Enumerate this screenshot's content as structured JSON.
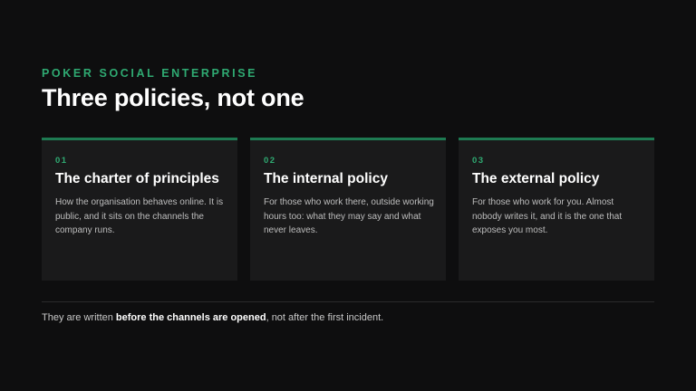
{
  "header": {
    "kicker": "POKER SOCIAL ENTERPRISE",
    "title": "Three policies, not one"
  },
  "cards": [
    {
      "number": "01",
      "heading": "The charter of principles",
      "body": "How the organisation behaves online. It is public, and it sits on the channels the company runs."
    },
    {
      "number": "02",
      "heading": "The internal policy",
      "body": "For those who work there, outside working hours too: what they may say and what never leaves."
    },
    {
      "number": "03",
      "heading": "The external policy",
      "body": "For those who work for you. Almost nobody writes it, and it is the one that exposes you most."
    }
  ],
  "footer": {
    "before": "They are written ",
    "emphasis": "before the channels are opened",
    "after": ", not after the first incident."
  },
  "colors": {
    "background": "#0e0e0f",
    "accent": "#2faa72",
    "card_border": "#1e7a52",
    "card_background": "#1a1a1b"
  }
}
